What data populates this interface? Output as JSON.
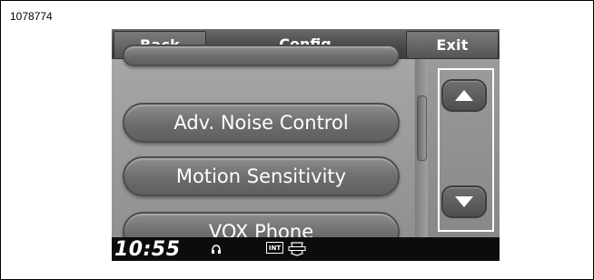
{
  "figure_id": "1078774",
  "topbar": {
    "back_label": "Back",
    "title": "Config",
    "exit_label": "Exit"
  },
  "menu": {
    "items": [
      {
        "label": "Adv. Noise Control"
      },
      {
        "label": "Motion Sensitivity"
      },
      {
        "label": "VOX Phone"
      }
    ]
  },
  "status": {
    "time": "10:55",
    "icons": [
      "headset-icon",
      "int-badge-icon",
      "brand-logo-icon"
    ],
    "int_label": "INT"
  },
  "scroll": {
    "up_icon": "triangle-up-icon",
    "down_icon": "triangle-down-icon"
  },
  "colors": {
    "highlight": "#ffffff",
    "statusbar": "#0c0c0c",
    "pill": "#6c6c6c"
  }
}
